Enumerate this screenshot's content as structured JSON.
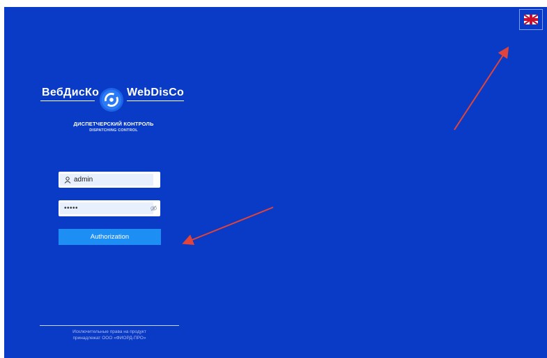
{
  "language": {
    "flag_icon": "uk-flag-icon"
  },
  "brand": {
    "name_ru": "ВебДисКо",
    "name_en": "WebDisCo",
    "subtitle_ru": "ДИСПЕТЧЕРСКИЙ КОНТРОЛЬ",
    "subtitle_en": "DISPATCHING CONTROL",
    "logo_icon": "gear-icon"
  },
  "login": {
    "username_value": "admin",
    "password_mask": "•••••",
    "user_icon": "user-icon",
    "eye_icon": "eye-slash-icon",
    "submit_label": "Authorization"
  },
  "footer": {
    "line1": "Исключительные права на продукт",
    "line2": "принадлежат ООО «ФИОРД-ПРО»"
  },
  "colors": {
    "background": "#0a3bc6",
    "button": "#1d8ef3",
    "annotation_arrow": "#e0443a"
  }
}
